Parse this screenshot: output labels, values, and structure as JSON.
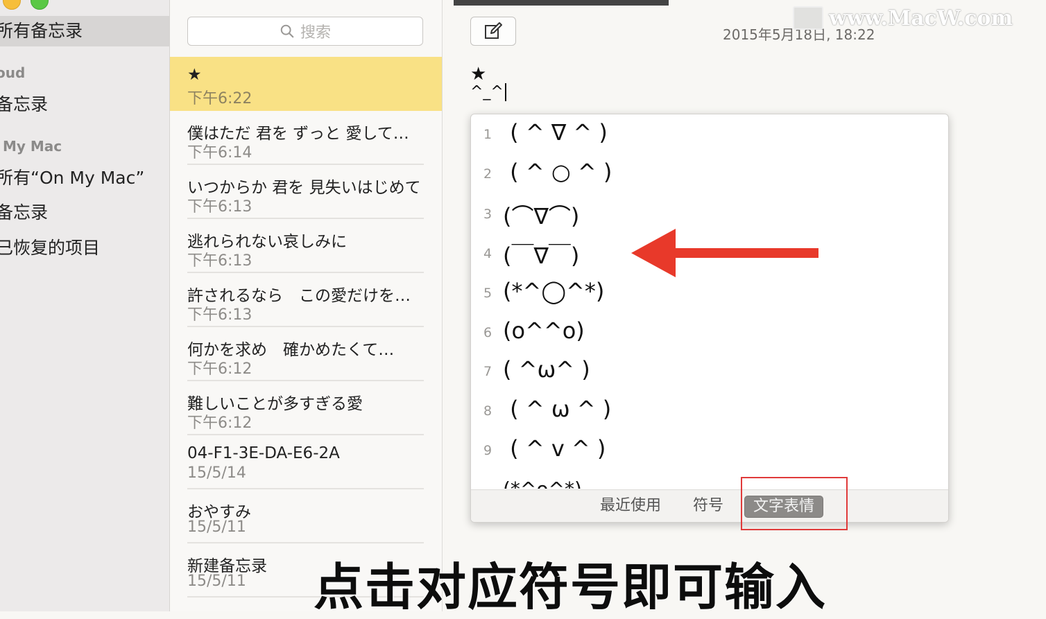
{
  "sidebar": {
    "items": [
      {
        "label": "所有备忘录",
        "selected": true
      },
      {
        "label": "oud",
        "type": "header"
      },
      {
        "label": "备忘录"
      },
      {
        "label": "My Mac",
        "type": "header"
      },
      {
        "label": "所有“On My Mac”"
      },
      {
        "label": "备忘录"
      },
      {
        "label": "已恢复的项目"
      }
    ]
  },
  "search": {
    "placeholder": "搜索"
  },
  "notes": [
    {
      "title": "★",
      "date": "下午6:22",
      "selected": true
    },
    {
      "title": "僕はただ 君を ずっと 愛して…",
      "date": "下午6:14"
    },
    {
      "title": "いつからか 君を 見失いはじめて",
      "date": "下午6:13"
    },
    {
      "title": "逃れられない哀しみに",
      "date": "下午6:13"
    },
    {
      "title": "許されるなら　この愛だけを…",
      "date": "下午6:13"
    },
    {
      "title": "何かを求め　確かめたくて…",
      "date": "下午6:12"
    },
    {
      "title": "難しいことが多すぎる愛",
      "date": "下午6:12"
    },
    {
      "title": "04-F1-3E-DA-E6-2A",
      "date": "15/5/14"
    },
    {
      "title": "おやすみ",
      "date": "15/5/11"
    },
    {
      "title": "新建备忘录",
      "date": "15/5/11"
    }
  ],
  "editor": {
    "date": "2015年5月18日, 18:22",
    "line1": "★",
    "line2": "^_^",
    "watermark": "www.MacW.com"
  },
  "emoji_popup": {
    "candidates": [
      {
        "n": "1",
        "k": " ( ^ ∇ ^ )"
      },
      {
        "n": "2",
        "k": " ( ^ ○ ^ )"
      },
      {
        "n": "3",
        "k": "(⌒∇⌒)"
      },
      {
        "n": "4",
        "k": "(￣∇￣)"
      },
      {
        "n": "5",
        "k": "(*^◯^*)"
      },
      {
        "n": "6",
        "k": "(o^^o)"
      },
      {
        "n": "7",
        "k": "( ^ω^ )"
      },
      {
        "n": "8",
        "k": " ( ^ ω ^ )"
      },
      {
        "n": "9",
        "k": " ( ^ v ^ )"
      },
      {
        "n": "",
        "k": "(*^o^*)"
      }
    ],
    "tabs": {
      "recent": "最近使用",
      "symbols": "符号",
      "emoticons": "文字表情"
    }
  },
  "subtitle": "点击对应符号即可输入",
  "colors": {
    "selected_note": "#f9e185",
    "highlight_box": "#e03a3a",
    "arrow": "#e8392a"
  }
}
